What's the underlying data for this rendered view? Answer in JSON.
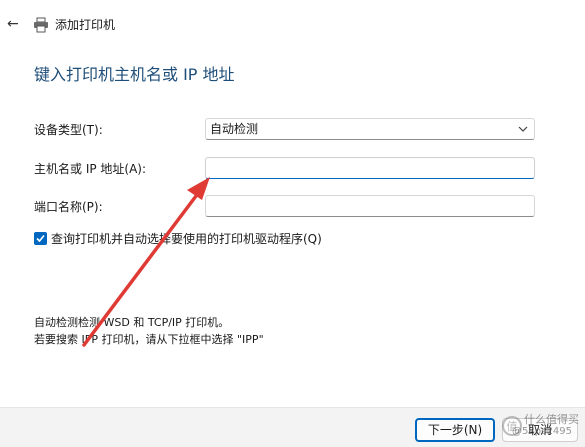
{
  "window": {
    "title": "添加打印机",
    "back_icon": "arrow-left-icon",
    "printer_icon": "printer-icon"
  },
  "heading": "键入打印机主机名或 IP 地址",
  "form": {
    "device_type_label": "设备类型(T):",
    "device_type_value": "自动检测",
    "hostname_label": "主机名或 IP 地址(A):",
    "hostname_value": "",
    "port_label": "端口名称(P):",
    "port_value": "",
    "query_checkbox_label": "查询打印机并自动选择要使用的打印机驱动程序(Q)",
    "query_checked": true
  },
  "description": {
    "line1": "自动检测检测 WSD 和 TCP/IP 打印机。",
    "line2": "若要搜索 IPP 打印机，请从下拉框中选择 \"IPP\""
  },
  "buttons": {
    "next": "下一步(N)",
    "cancel": "取消"
  },
  "watermark": {
    "line1": "什么值得买",
    "line2": "@52pc2495"
  },
  "colors": {
    "accent": "#0067c0",
    "heading": "#1f4e79",
    "annotation_arrow": "#e03a35"
  }
}
